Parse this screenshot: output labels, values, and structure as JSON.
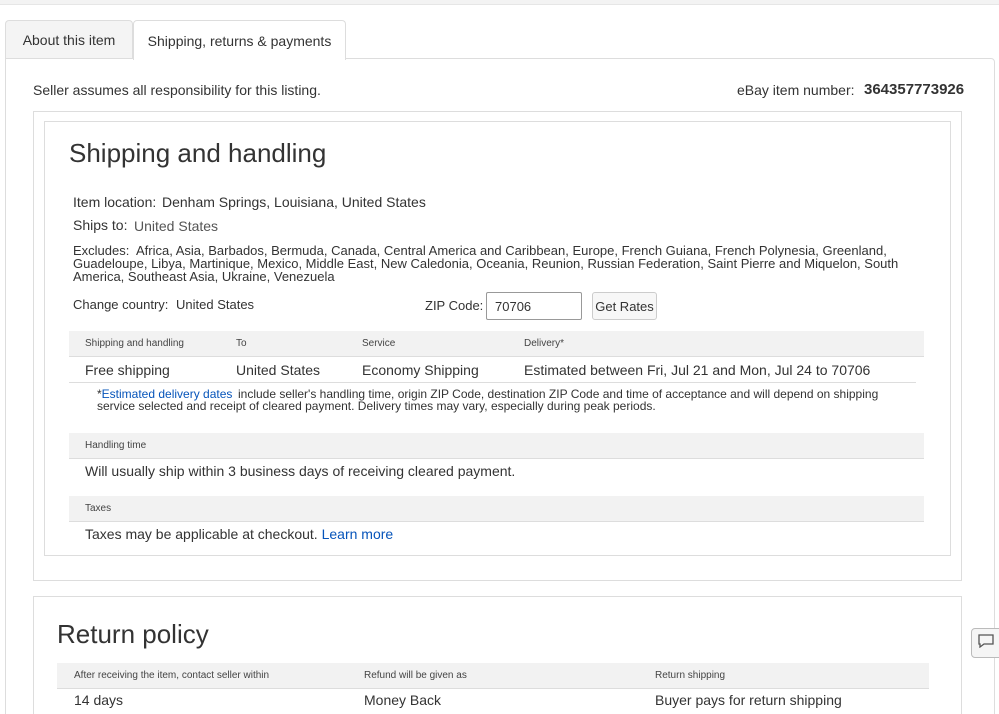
{
  "tabs": {
    "about": "About this item",
    "shipping": "Shipping, returns & payments"
  },
  "seller_note": "Seller assumes all responsibility for this listing.",
  "item_number": {
    "label": "eBay item number:",
    "value": "364357773926"
  },
  "shipping_section": {
    "title": "Shipping and handling",
    "location_label": "Item location:",
    "location_value": "Denham Springs, Louisiana, United States",
    "ships_to_label": "Ships to:",
    "ships_to_value": "United States",
    "excludes_label": "Excludes:",
    "excludes_line1": "Africa, Asia, Barbados, Bermuda, Canada, Central America and Caribbean, Europe, French Guiana, French Polynesia, Greenland,",
    "excludes_line2": "Guadeloupe, Libya, Martinique, Mexico, Middle East, New Caledonia, Oceania, Reunion, Russian Federation, Saint Pierre and Miquelon, South",
    "excludes_line3": "America, Southeast Asia, Ukraine, Venezuela",
    "country_label": "Change country:",
    "country_value": "United States",
    "zip_label": "ZIP Code:",
    "zip_value": "70706",
    "get_rates": "Get Rates",
    "table_headers": {
      "col1": "Shipping and handling",
      "col2": "To",
      "col3": "Service",
      "col4": "Delivery*"
    },
    "row": {
      "cost": "Free shipping",
      "to": "United States",
      "service": "Economy Shipping",
      "delivery_prefix": "Estimated between",
      "delivery_range": "Fri, Jul 21",
      "delivery_and": "and",
      "delivery_range2": "Mon, Jul 24",
      "delivery_suffix": "to 70706"
    },
    "note_star": "*",
    "note_link": "Estimated delivery dates",
    "note_line1": "include seller's handling time, origin ZIP Code, destination ZIP Code and time of acceptance and will depend on shipping",
    "note_line2": "service selected and receipt of cleared payment. Delivery times may vary, especially during peak periods.",
    "handling_header": "Handling time",
    "handling_text": "Will usually ship within 3 business days of receiving cleared payment.",
    "taxes_header": "Taxes",
    "taxes_text": "Taxes may be applicable at checkout.",
    "learn_more": "Learn more"
  },
  "return_section": {
    "title": "Return policy",
    "headers": {
      "col1": "After receiving the item, contact seller within",
      "col2": "Refund will be given as",
      "col3": "Return shipping"
    },
    "values": {
      "col1": "14 days",
      "col2": "Money Back",
      "col3": "Buyer pays for return shipping"
    }
  },
  "icons": {
    "feedback": "feedback-icon"
  }
}
